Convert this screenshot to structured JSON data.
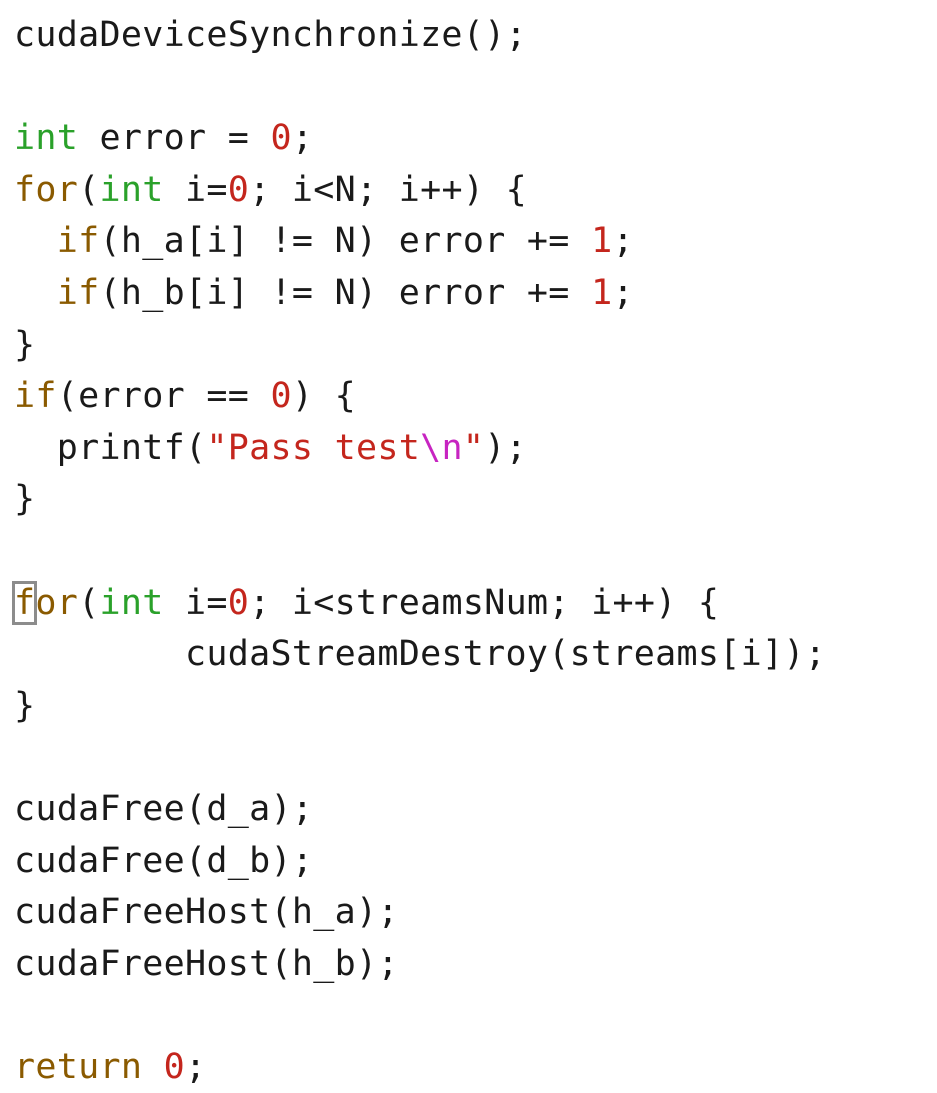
{
  "colors": {
    "background": "#ffffff",
    "plain": "#1a1a1a",
    "keyword": "#8a5a00",
    "type": "#2aa12a",
    "number": "#c4261d",
    "string": "#c4261d",
    "escape": "#c724c1",
    "cursor": "#8c8c8c"
  },
  "cursor": {
    "line": 11,
    "token": 0,
    "char": "f"
  },
  "lines": [
    [
      {
        "t": "plain",
        "s": "cudaDeviceSynchronize();"
      }
    ],
    [],
    [
      {
        "t": "type",
        "s": "int"
      },
      {
        "t": "plain",
        "s": " error = "
      },
      {
        "t": "number",
        "s": "0"
      },
      {
        "t": "plain",
        "s": ";"
      }
    ],
    [
      {
        "t": "keyword",
        "s": "for"
      },
      {
        "t": "plain",
        "s": "("
      },
      {
        "t": "type",
        "s": "int"
      },
      {
        "t": "plain",
        "s": " i="
      },
      {
        "t": "number",
        "s": "0"
      },
      {
        "t": "plain",
        "s": "; i<N; i++) {"
      }
    ],
    [
      {
        "t": "plain",
        "s": "  "
      },
      {
        "t": "keyword",
        "s": "if"
      },
      {
        "t": "plain",
        "s": "(h_a[i] != N) error += "
      },
      {
        "t": "number",
        "s": "1"
      },
      {
        "t": "plain",
        "s": ";"
      }
    ],
    [
      {
        "t": "plain",
        "s": "  "
      },
      {
        "t": "keyword",
        "s": "if"
      },
      {
        "t": "plain",
        "s": "(h_b[i] != N) error += "
      },
      {
        "t": "number",
        "s": "1"
      },
      {
        "t": "plain",
        "s": ";"
      }
    ],
    [
      {
        "t": "plain",
        "s": "}"
      }
    ],
    [
      {
        "t": "keyword",
        "s": "if"
      },
      {
        "t": "plain",
        "s": "(error == "
      },
      {
        "t": "number",
        "s": "0"
      },
      {
        "t": "plain",
        "s": ") {"
      }
    ],
    [
      {
        "t": "plain",
        "s": "  printf("
      },
      {
        "t": "string",
        "s": "\"Pass test"
      },
      {
        "t": "escape",
        "s": "\\n"
      },
      {
        "t": "string",
        "s": "\""
      },
      {
        "t": "plain",
        "s": ");"
      }
    ],
    [
      {
        "t": "plain",
        "s": "}"
      }
    ],
    [],
    [
      {
        "t": "keyword",
        "s": "for"
      },
      {
        "t": "plain",
        "s": "("
      },
      {
        "t": "type",
        "s": "int"
      },
      {
        "t": "plain",
        "s": " i="
      },
      {
        "t": "number",
        "s": "0"
      },
      {
        "t": "plain",
        "s": "; i<streamsNum; i++) {"
      }
    ],
    [
      {
        "t": "plain",
        "s": "        cudaStreamDestroy(streams[i]);"
      }
    ],
    [
      {
        "t": "plain",
        "s": "}"
      }
    ],
    [],
    [
      {
        "t": "plain",
        "s": "cudaFree(d_a);"
      }
    ],
    [
      {
        "t": "plain",
        "s": "cudaFree(d_b);"
      }
    ],
    [
      {
        "t": "plain",
        "s": "cudaFreeHost(h_a);"
      }
    ],
    [
      {
        "t": "plain",
        "s": "cudaFreeHost(h_b);"
      }
    ],
    [],
    [
      {
        "t": "keyword",
        "s": "return"
      },
      {
        "t": "plain",
        "s": " "
      },
      {
        "t": "number",
        "s": "0"
      },
      {
        "t": "plain",
        "s": ";"
      }
    ]
  ]
}
